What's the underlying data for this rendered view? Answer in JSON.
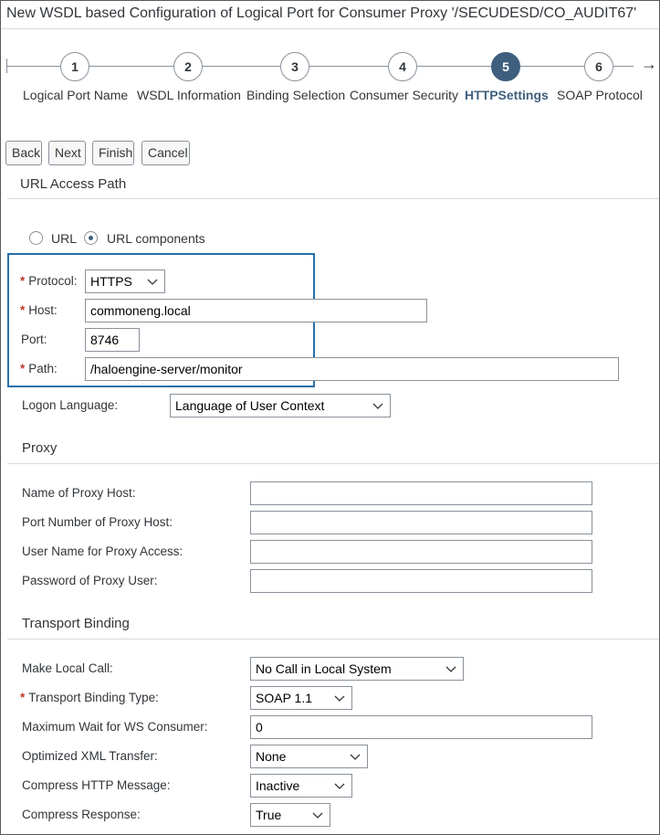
{
  "window": {
    "title": "New WSDL based Configuration of Logical Port for Consumer Proxy '/SECUDESD/CO_AUDIT67'"
  },
  "wizard": {
    "steps": [
      {
        "number": "1",
        "label": "Logical Port Name"
      },
      {
        "number": "2",
        "label": "WSDL Information"
      },
      {
        "number": "3",
        "label": "Binding Selection"
      },
      {
        "number": "4",
        "label": "Consumer Security"
      },
      {
        "number": "5",
        "label": "HTTPSettings"
      },
      {
        "number": "6",
        "label": "SOAP Protocol"
      }
    ],
    "active_step": 5
  },
  "toolbar": {
    "back": "Back",
    "next": "Next",
    "finish": "Finish",
    "cancel": "Cancel"
  },
  "url_access": {
    "section_title": "URL Access Path",
    "radio_url": "URL",
    "radio_components": "URL components",
    "selected": "URL components",
    "protocol_label": "Protocol:",
    "protocol_value": "HTTPS",
    "host_label": "Host:",
    "host_value": "commoneng.local",
    "port_label": "Port:",
    "port_value": "8746",
    "path_label": "Path:",
    "path_value": "/haloengine-server/monitor",
    "logon_label": "Logon Language:",
    "logon_value": "Language of User Context"
  },
  "proxy": {
    "section_title": "Proxy",
    "host_label": "Name of Proxy Host:",
    "host_value": "",
    "port_label": "Port Number of Proxy Host:",
    "port_value": "",
    "user_label": "User Name for Proxy Access:",
    "user_value": "",
    "password_label": "Password of Proxy User:",
    "password_value": ""
  },
  "transport": {
    "section_title": "Transport Binding",
    "local_call_label": "Make Local Call:",
    "local_call_value": "No Call in Local System",
    "binding_type_label": "Transport Binding Type:",
    "binding_type_value": "SOAP 1.1",
    "max_wait_label": "Maximum Wait for WS Consumer:",
    "max_wait_value": "0",
    "xml_label": "Optimized XML Transfer:",
    "xml_value": "None",
    "compress_http_label": "Compress HTTP Message:",
    "compress_http_value": "Inactive",
    "compress_resp_label": "Compress Response:",
    "compress_resp_value": "True"
  },
  "colors": {
    "accent": "#3f5f7e",
    "highlight_border": "#2a6fa8",
    "required": "#c0392b"
  }
}
